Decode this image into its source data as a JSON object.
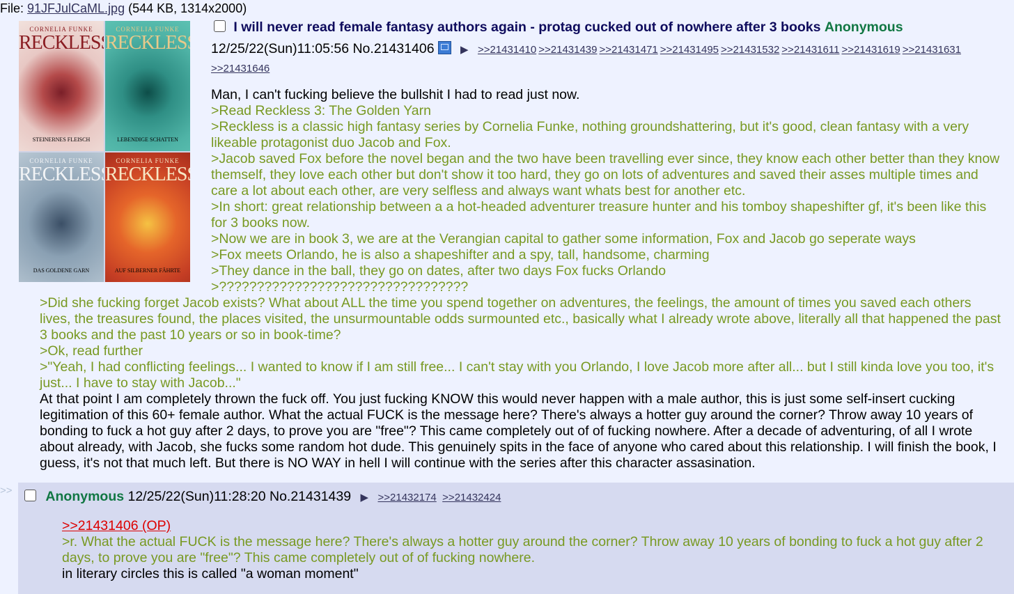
{
  "file": {
    "prefix": "File: ",
    "name": "91JFJulCaML.jpg",
    "info": " (544 KB, 1314x2000)"
  },
  "thumbnail": {
    "author": "CORNELIA FUNKE",
    "covers": [
      {
        "title": "RECKLESS",
        "subtitle": "STEINERNES FLEISCH"
      },
      {
        "title": "RECKLESS",
        "subtitle": "LEBENDIGE SCHATTEN"
      },
      {
        "title": "RECKLESS",
        "subtitle": "DAS GOLDENE GARN"
      },
      {
        "title": "RECKLESS",
        "subtitle": "AUF SILBERNER FÄHRTE"
      }
    ]
  },
  "op": {
    "subject": "I will never read female fantasy authors again - protag cucked out of nowhere after 3 books",
    "name": "Anonymous",
    "datetime": "12/25/22(Sun)11:05:56",
    "number": "No.21431406",
    "arrow": "▶",
    "replies": [
      ">>21431410",
      ">>21431439",
      ">>21431471",
      ">>21431495",
      ">>21431532",
      ">>21431611",
      ">>21431619",
      ">>21431631"
    ],
    "replies_wrap": ">>21431646",
    "lines": [
      "Man, I can't fucking believe the bullshit I had to read just now.",
      ">Read Reckless 3: The Golden Yarn",
      ">Reckless is a classic high fantasy series by Cornelia Funke, nothing groundshattering, but it's good, clean fantasy with a very likeable protagonist duo Jacob and Fox.",
      ">Jacob saved Fox before the novel began and the two have been travelling ever since, they know each other better than they know themself, they love each other but don't show it too hard, they go on lots of adventures and saved their asses multiple times and care a lot about each other, are very selfless and always want whats best for another etc.",
      ">In short: great relationship between a a hot-headed adventurer treasure hunter and his tomboy shapeshifter gf, it's been like this for 3 books now.",
      ">Now we are in book 3, we are at the Verangian capital to gather some information, Fox and Jacob go seperate ways",
      ">Fox meets Orlando, he is also a shapeshifter and a spy, tall, handsome, charming",
      ">They dance in the ball, they go on dates, after two days Fox fucks Orlando",
      ">?????????????????????????????????"
    ],
    "lines_wide": [
      ">Did she fucking forget Jacob exists? What about ALL the time you spend together on adventures, the feelings, the amount of times you saved each others lives, the treasures found, the places visited, the unsurmountable odds surmounted etc., basically what I already wrote above, literally all that happened the past 3 books and the past 10 years or so in book-time?",
      ">Ok, read further",
      ">\"Yeah, I had conflicting feelings... I wanted to know if I am still free... I can't stay with you Orlando, I love Jacob more after all... but I still kinda love you too, it's just... I have to stay with Jacob...\"",
      "At that point I am completely thrown the fuck off. You just fucking KNOW this would never happen with a male author, this is just some self-insert cucking legitimation of this 60+ female author. What the actual FUCK is the message here? There's always a hotter guy around the corner? Throw away 10 years of bonding to fuck a hot guy after 2 days, to prove you are \"free\"? This came completely out of of fucking nowhere. After a decade of adventuring, of all I wrote about already, with Jacob, she fucks some random hot dude. This genuinely spits in the face of anyone who cared about this relationship. I will finish the book, I guess, it's not that much left. But there is NO WAY in hell I will continue with the series after this character assasination."
    ]
  },
  "reply": {
    "side": ">>",
    "name": "Anonymous",
    "datetime": "12/25/22(Sun)11:28:20",
    "number": "No.21431439",
    "arrow": "▶",
    "replies": [
      ">>21432174",
      ">>21432424"
    ],
    "quotelink": ">>21431406 (OP)",
    "lines": [
      ">r. What the actual FUCK is the message here? There's always a hotter guy around the corner? Throw away 10 years of bonding to fuck a hot guy after 2 days, to prove you are \"free\"? This came completely out of of fucking nowhere.",
      "in literary circles this is called \"a woman moment\""
    ]
  },
  "colors": {
    "background": "#eef2ff",
    "reply_bg": "#d6daf0",
    "greentext": "#789922",
    "name": "#117743",
    "subject": "#0f0c5d",
    "deadlink": "#dd0000"
  }
}
